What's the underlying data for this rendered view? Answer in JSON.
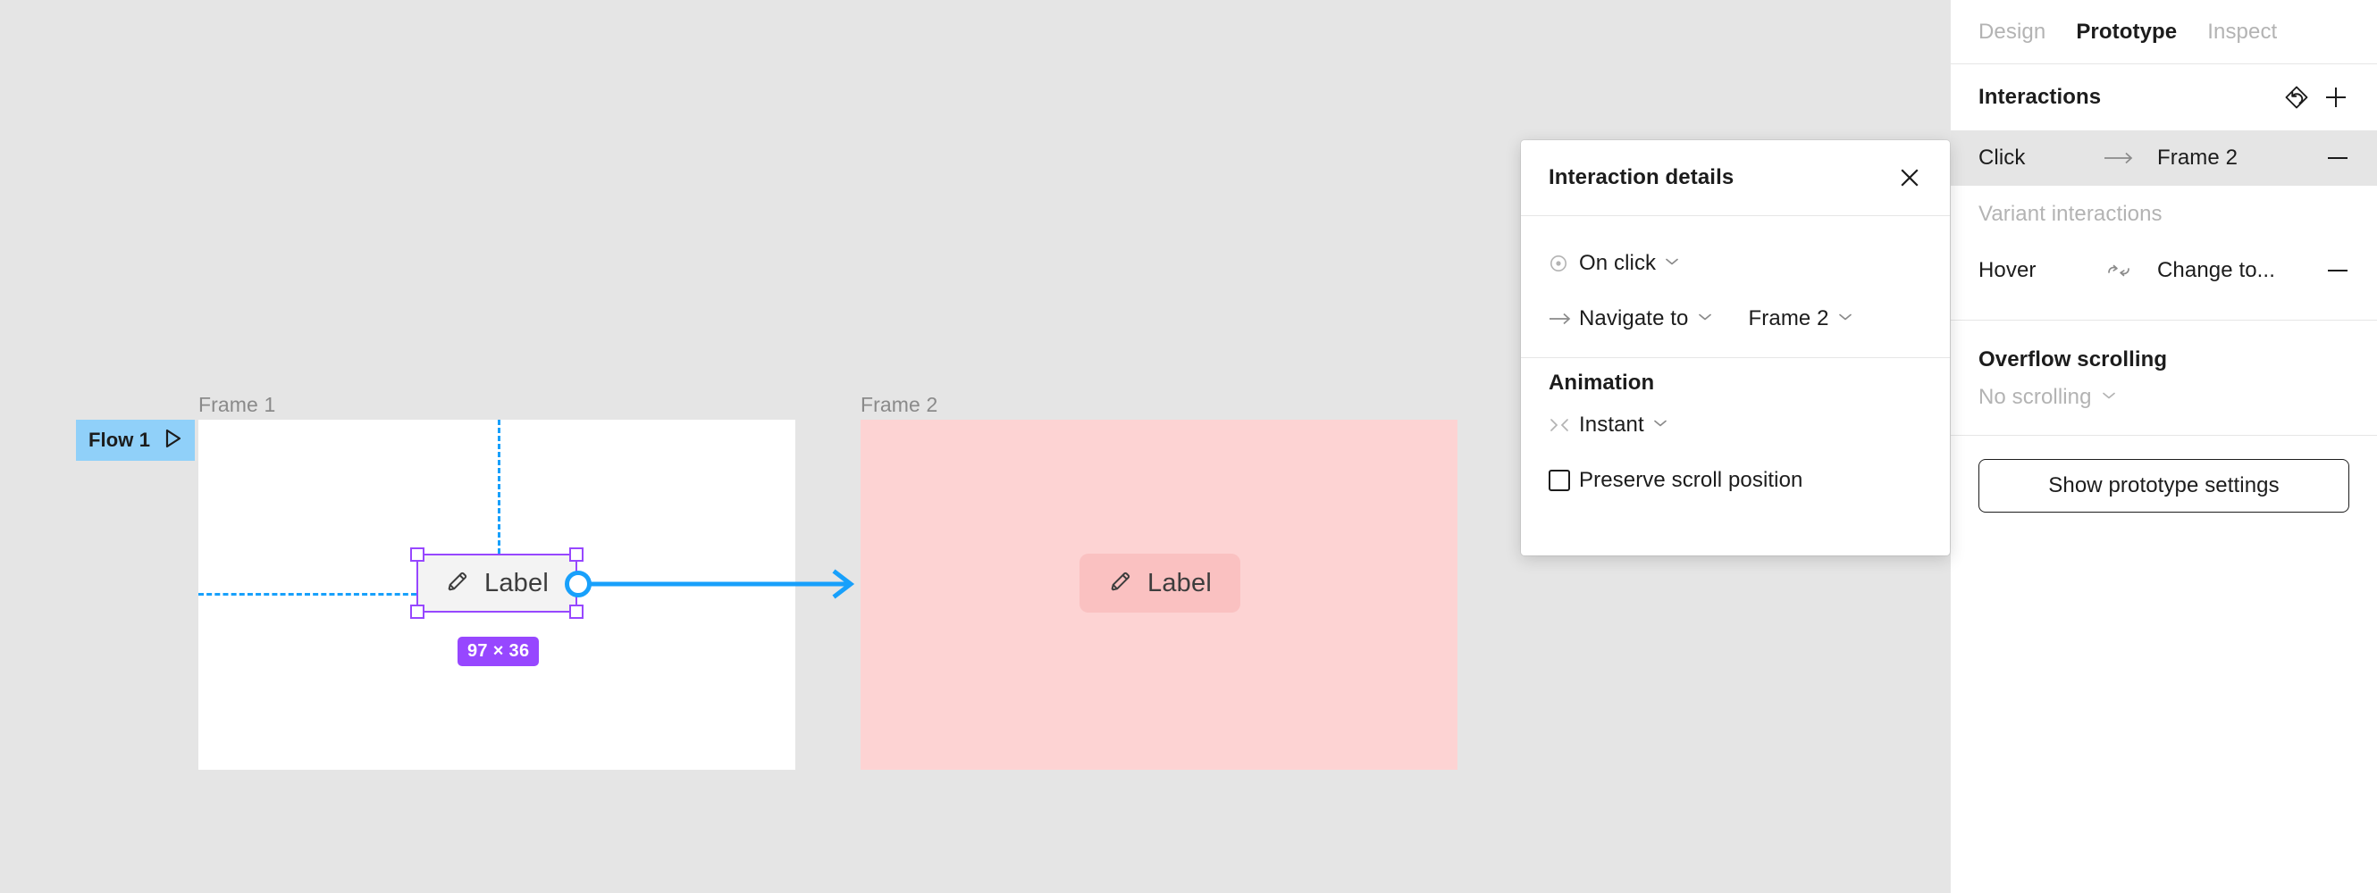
{
  "canvas": {
    "flow": {
      "name": "Flow 1",
      "play_icon": "play-triangle-icon"
    },
    "frames": [
      {
        "label": "Frame 1",
        "bg": "#ffffff"
      },
      {
        "label": "Frame 2",
        "bg": "#fdd3d3"
      }
    ],
    "label_elements": [
      {
        "text": "Label",
        "icon": "pencil-icon"
      },
      {
        "text": "Label",
        "icon": "pencil-icon"
      }
    ],
    "selection": {
      "size_badge": "97 × 36",
      "selection_color": "#9747ff",
      "guide_color": "#18a0fb",
      "connector_color": "#18a0fb"
    }
  },
  "popup": {
    "title": "Interaction details",
    "close_icon": "close-icon",
    "trigger": {
      "icon": "click-target-icon",
      "value": "On click",
      "chevron": "chevron-down-icon"
    },
    "action": {
      "icon": "arrow-right-icon",
      "value": "Navigate to",
      "chevron": "chevron-down-icon",
      "destination": "Frame 2",
      "destination_chevron": "chevron-down-icon"
    },
    "animation": {
      "section_title": "Animation",
      "icon": "instant-icon",
      "value": "Instant",
      "chevron": "chevron-down-icon",
      "preserve_scroll": {
        "label": "Preserve scroll position",
        "checked": false
      }
    }
  },
  "right_panel": {
    "tabs": [
      {
        "label": "Design",
        "active": false
      },
      {
        "label": "Prototype",
        "active": true
      },
      {
        "label": "Inspect",
        "active": false
      }
    ],
    "interactions": {
      "title": "Interactions",
      "reset_icon": "reset-interactions-icon",
      "add_icon": "plus-icon",
      "rows": [
        {
          "trigger": "Click",
          "arrow_icon": "arrow-right-icon",
          "destination": "Frame 2",
          "remove_icon": "minus-icon",
          "selected": true
        }
      ],
      "variant_section": "Variant interactions",
      "variant_rows": [
        {
          "trigger": "Hover",
          "arrow_icon": "swap-icon",
          "destination": "Change to...",
          "remove_icon": "minus-icon",
          "selected": false
        }
      ]
    },
    "overflow": {
      "title": "Overflow scrolling",
      "value": "No scrolling",
      "chevron": "chevron-down-icon"
    },
    "show_prototype_settings": "Show prototype settings"
  }
}
